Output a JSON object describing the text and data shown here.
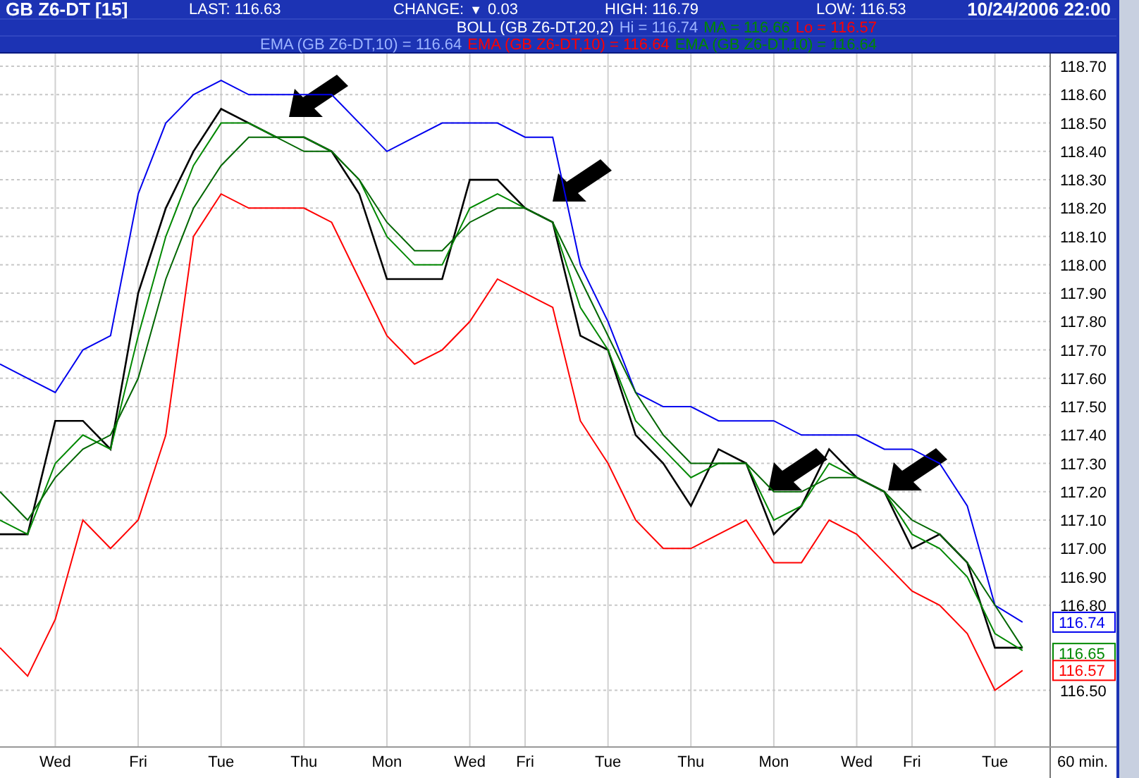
{
  "header": {
    "symbol": "GB Z6-DT [15]",
    "last": "LAST: 116.63",
    "change_label": "CHANGE:",
    "change_arrow": "▼",
    "change_value": "0.03",
    "high": "HIGH: 116.79",
    "low": "LOW: 116.53",
    "datetime": "10/24/2006 22:00"
  },
  "legend_rows": [
    [
      {
        "text": "BOLL (GB Z6-DT,20,2)",
        "color": "#ffffff"
      },
      {
        "text": "Hi = 116.74",
        "color": "#9db4ff"
      },
      {
        "text": "MA = 116.66",
        "color": "#008800"
      },
      {
        "text": "Lo = 116.57",
        "color": "#ff0000"
      }
    ],
    [
      {
        "text": "EMA (GB Z6-DT,10) = 116.64",
        "color": "#9db4ff"
      },
      {
        "text": "EMA (GB Z6-DT,10) = 116.64",
        "color": "#ff0000"
      },
      {
        "text": "EMA (GB Z6-DT,10) = 116.64",
        "color": "#008800"
      }
    ]
  ],
  "chart": {
    "chart_data": {
      "type": "line",
      "categories": [
        null,
        null,
        "Wed",
        null,
        null,
        "Fri",
        null,
        null,
        "Tue",
        null,
        null,
        "Thu",
        null,
        null,
        "Mon",
        null,
        null,
        "Wed",
        null,
        "Fri",
        null,
        null,
        "Tue",
        null,
        null,
        "Thu",
        null,
        null,
        "Mon",
        null,
        null,
        "Wed",
        null,
        "Fri",
        null,
        null,
        "Tue",
        null
      ],
      "ylim": [
        116.3,
        118.745
      ],
      "grid": true,
      "yticks": [
        {
          "value": 118.7,
          "label": "118.70"
        },
        {
          "value": 118.6,
          "label": "118.60"
        },
        {
          "value": 118.5,
          "label": "118.50"
        },
        {
          "value": 118.4,
          "label": "118.40"
        },
        {
          "value": 118.3,
          "label": "118.30"
        },
        {
          "value": 118.2,
          "label": "118.20"
        },
        {
          "value": 118.1,
          "label": "118.10"
        },
        {
          "value": 118.0,
          "label": "118.00"
        },
        {
          "value": 117.9,
          "label": "117.90"
        },
        {
          "value": 117.8,
          "label": "117.80"
        },
        {
          "value": 117.7,
          "label": "117.70"
        },
        {
          "value": 117.6,
          "label": "117.60"
        },
        {
          "value": 117.5,
          "label": "117.50"
        },
        {
          "value": 117.4,
          "label": "117.40"
        },
        {
          "value": 117.3,
          "label": "117.30"
        },
        {
          "value": 117.2,
          "label": "117.20"
        },
        {
          "value": 117.1,
          "label": "117.10"
        },
        {
          "value": 117.0,
          "label": "117.00"
        },
        {
          "value": 116.9,
          "label": "116.90"
        },
        {
          "value": 116.8,
          "label": "116.80"
        },
        {
          "value": 116.5,
          "label": "116.50"
        }
      ],
      "series": [
        {
          "color": "#000000",
          "values": [
            117.05,
            117.05,
            117.45,
            117.45,
            117.35,
            117.9,
            118.2,
            118.4,
            118.55,
            118.5,
            118.45,
            118.45,
            118.4,
            118.25,
            117.95,
            117.95,
            117.95,
            118.3,
            118.3,
            118.2,
            118.15,
            117.75,
            117.7,
            117.4,
            117.3,
            117.15,
            117.35,
            117.3,
            117.05,
            117.15,
            117.35,
            117.25,
            117.2,
            117.0,
            117.05,
            116.95,
            116.65,
            116.65
          ]
        },
        {
          "color": "#0000ee",
          "values": [
            117.65,
            117.6,
            117.55,
            117.7,
            117.75,
            118.25,
            118.5,
            118.6,
            118.65,
            118.6,
            118.6,
            118.6,
            118.6,
            118.5,
            118.4,
            118.45,
            118.5,
            118.5,
            118.5,
            118.45,
            118.45,
            118.0,
            117.8,
            117.55,
            117.5,
            117.5,
            117.45,
            117.45,
            117.45,
            117.4,
            117.4,
            117.4,
            117.35,
            117.35,
            117.3,
            117.15,
            116.8,
            116.74
          ]
        },
        {
          "color": "#ff0000",
          "values": [
            116.65,
            116.55,
            116.75,
            117.1,
            117.0,
            117.1,
            117.4,
            118.1,
            118.25,
            118.2,
            118.2,
            118.2,
            118.15,
            117.95,
            117.75,
            117.65,
            117.7,
            117.8,
            117.95,
            117.9,
            117.85,
            117.45,
            117.3,
            117.1,
            117.0,
            117.0,
            117.05,
            117.1,
            116.95,
            116.95,
            117.1,
            117.05,
            116.95,
            116.85,
            116.8,
            116.7,
            116.5,
            116.57
          ]
        },
        {
          "color": "#008800",
          "values": [
            117.1,
            117.05,
            117.3,
            117.4,
            117.35,
            117.75,
            118.1,
            118.35,
            118.5,
            118.5,
            118.45,
            118.45,
            118.4,
            118.3,
            118.1,
            118.0,
            118.0,
            118.2,
            118.25,
            118.2,
            118.15,
            117.85,
            117.7,
            117.45,
            117.35,
            117.25,
            117.3,
            117.3,
            117.1,
            117.15,
            117.3,
            117.25,
            117.2,
            117.05,
            117.0,
            116.9,
            116.7,
            116.64
          ]
        },
        {
          "color": "#006600",
          "values": [
            117.2,
            117.1,
            117.25,
            117.35,
            117.4,
            117.6,
            117.95,
            118.2,
            118.35,
            118.45,
            118.45,
            118.4,
            118.4,
            118.3,
            118.15,
            118.05,
            118.05,
            118.15,
            118.2,
            118.2,
            118.15,
            117.95,
            117.75,
            117.55,
            117.4,
            117.3,
            117.3,
            117.3,
            117.2,
            117.2,
            117.25,
            117.25,
            117.2,
            117.1,
            117.05,
            116.95,
            116.8,
            116.65
          ]
        }
      ]
    },
    "price_tags": [
      {
        "label": "116.74",
        "color": "#0000ee"
      },
      {
        "label": "116.65",
        "color": "#008800"
      },
      {
        "label": "116.57",
        "color": "#ff0000"
      }
    ],
    "interval": "60 min."
  }
}
